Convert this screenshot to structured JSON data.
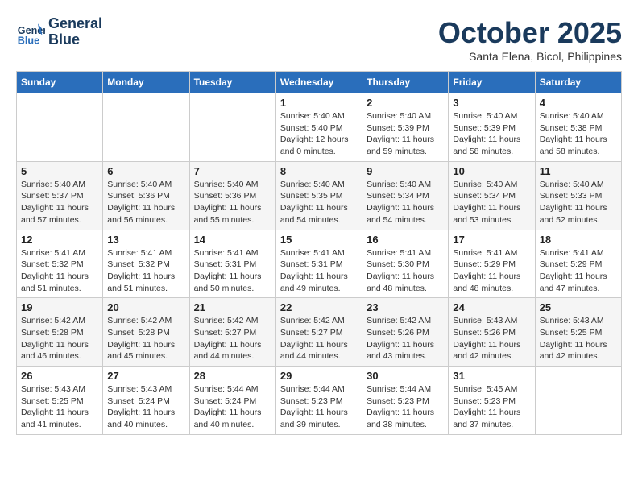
{
  "header": {
    "logo_line1": "General",
    "logo_line2": "Blue",
    "month": "October 2025",
    "location": "Santa Elena, Bicol, Philippines"
  },
  "weekdays": [
    "Sunday",
    "Monday",
    "Tuesday",
    "Wednesday",
    "Thursday",
    "Friday",
    "Saturday"
  ],
  "weeks": [
    [
      {
        "day": "",
        "info": ""
      },
      {
        "day": "",
        "info": ""
      },
      {
        "day": "",
        "info": ""
      },
      {
        "day": "1",
        "info": "Sunrise: 5:40 AM\nSunset: 5:40 PM\nDaylight: 12 hours\nand 0 minutes."
      },
      {
        "day": "2",
        "info": "Sunrise: 5:40 AM\nSunset: 5:39 PM\nDaylight: 11 hours\nand 59 minutes."
      },
      {
        "day": "3",
        "info": "Sunrise: 5:40 AM\nSunset: 5:39 PM\nDaylight: 11 hours\nand 58 minutes."
      },
      {
        "day": "4",
        "info": "Sunrise: 5:40 AM\nSunset: 5:38 PM\nDaylight: 11 hours\nand 58 minutes."
      }
    ],
    [
      {
        "day": "5",
        "info": "Sunrise: 5:40 AM\nSunset: 5:37 PM\nDaylight: 11 hours\nand 57 minutes."
      },
      {
        "day": "6",
        "info": "Sunrise: 5:40 AM\nSunset: 5:36 PM\nDaylight: 11 hours\nand 56 minutes."
      },
      {
        "day": "7",
        "info": "Sunrise: 5:40 AM\nSunset: 5:36 PM\nDaylight: 11 hours\nand 55 minutes."
      },
      {
        "day": "8",
        "info": "Sunrise: 5:40 AM\nSunset: 5:35 PM\nDaylight: 11 hours\nand 54 minutes."
      },
      {
        "day": "9",
        "info": "Sunrise: 5:40 AM\nSunset: 5:34 PM\nDaylight: 11 hours\nand 54 minutes."
      },
      {
        "day": "10",
        "info": "Sunrise: 5:40 AM\nSunset: 5:34 PM\nDaylight: 11 hours\nand 53 minutes."
      },
      {
        "day": "11",
        "info": "Sunrise: 5:40 AM\nSunset: 5:33 PM\nDaylight: 11 hours\nand 52 minutes."
      }
    ],
    [
      {
        "day": "12",
        "info": "Sunrise: 5:41 AM\nSunset: 5:32 PM\nDaylight: 11 hours\nand 51 minutes."
      },
      {
        "day": "13",
        "info": "Sunrise: 5:41 AM\nSunset: 5:32 PM\nDaylight: 11 hours\nand 51 minutes."
      },
      {
        "day": "14",
        "info": "Sunrise: 5:41 AM\nSunset: 5:31 PM\nDaylight: 11 hours\nand 50 minutes."
      },
      {
        "day": "15",
        "info": "Sunrise: 5:41 AM\nSunset: 5:31 PM\nDaylight: 11 hours\nand 49 minutes."
      },
      {
        "day": "16",
        "info": "Sunrise: 5:41 AM\nSunset: 5:30 PM\nDaylight: 11 hours\nand 48 minutes."
      },
      {
        "day": "17",
        "info": "Sunrise: 5:41 AM\nSunset: 5:29 PM\nDaylight: 11 hours\nand 48 minutes."
      },
      {
        "day": "18",
        "info": "Sunrise: 5:41 AM\nSunset: 5:29 PM\nDaylight: 11 hours\nand 47 minutes."
      }
    ],
    [
      {
        "day": "19",
        "info": "Sunrise: 5:42 AM\nSunset: 5:28 PM\nDaylight: 11 hours\nand 46 minutes."
      },
      {
        "day": "20",
        "info": "Sunrise: 5:42 AM\nSunset: 5:28 PM\nDaylight: 11 hours\nand 45 minutes."
      },
      {
        "day": "21",
        "info": "Sunrise: 5:42 AM\nSunset: 5:27 PM\nDaylight: 11 hours\nand 44 minutes."
      },
      {
        "day": "22",
        "info": "Sunrise: 5:42 AM\nSunset: 5:27 PM\nDaylight: 11 hours\nand 44 minutes."
      },
      {
        "day": "23",
        "info": "Sunrise: 5:42 AM\nSunset: 5:26 PM\nDaylight: 11 hours\nand 43 minutes."
      },
      {
        "day": "24",
        "info": "Sunrise: 5:43 AM\nSunset: 5:26 PM\nDaylight: 11 hours\nand 42 minutes."
      },
      {
        "day": "25",
        "info": "Sunrise: 5:43 AM\nSunset: 5:25 PM\nDaylight: 11 hours\nand 42 minutes."
      }
    ],
    [
      {
        "day": "26",
        "info": "Sunrise: 5:43 AM\nSunset: 5:25 PM\nDaylight: 11 hours\nand 41 minutes."
      },
      {
        "day": "27",
        "info": "Sunrise: 5:43 AM\nSunset: 5:24 PM\nDaylight: 11 hours\nand 40 minutes."
      },
      {
        "day": "28",
        "info": "Sunrise: 5:44 AM\nSunset: 5:24 PM\nDaylight: 11 hours\nand 40 minutes."
      },
      {
        "day": "29",
        "info": "Sunrise: 5:44 AM\nSunset: 5:23 PM\nDaylight: 11 hours\nand 39 minutes."
      },
      {
        "day": "30",
        "info": "Sunrise: 5:44 AM\nSunset: 5:23 PM\nDaylight: 11 hours\nand 38 minutes."
      },
      {
        "day": "31",
        "info": "Sunrise: 5:45 AM\nSunset: 5:23 PM\nDaylight: 11 hours\nand 37 minutes."
      },
      {
        "day": "",
        "info": ""
      }
    ]
  ]
}
